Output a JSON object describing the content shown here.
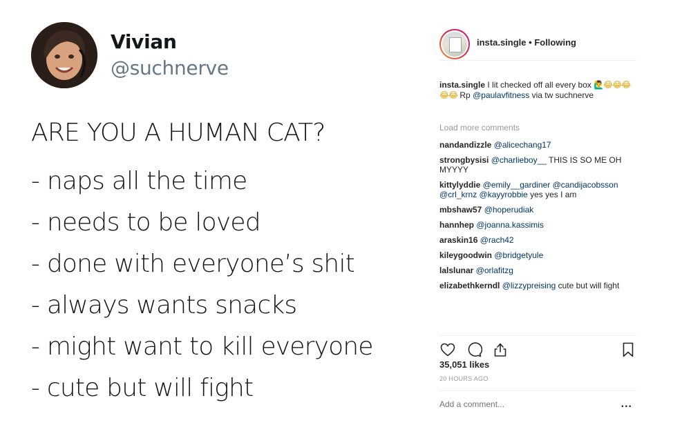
{
  "tweet": {
    "name": "Vivian",
    "handle": "@suchnerve",
    "heading": "ARE YOU A HUMAN CAT?",
    "items": [
      "- naps all the time",
      "- needs to be loved",
      "- done with everyone’s shit",
      "- always wants snacks",
      "- might want to kill everyone",
      "- cute but will fight"
    ]
  },
  "instagram": {
    "header": {
      "username": "insta.single",
      "separator": " • ",
      "follow_status": "Following"
    },
    "caption": {
      "username": "insta.single",
      "text_before": " I lit checked off all every box ",
      "emoji": "🙋‍♂️😂😂😂😂😂",
      "text_rp": " Rp ",
      "mention": "@paulavfitness",
      "text_after": " via tw suchnerve"
    },
    "load_more": "Load more comments",
    "comments": [
      {
        "username": "nandandizzle",
        "mentions": "@alicechang17",
        "text": ""
      },
      {
        "username": "strongbysisi",
        "mentions": "@charlieboy__",
        "text": " THIS IS SO ME OH MYYYY"
      },
      {
        "username": "kittylyddie",
        "mentions": "@emily__gardiner @candijacobsson @crl_krnz @kayyrobbie",
        "text": " yes yes I am"
      },
      {
        "username": "mbshaw57",
        "mentions": "@hoperudiak",
        "text": ""
      },
      {
        "username": "hannhep",
        "mentions": "@joanna.kassimis",
        "text": ""
      },
      {
        "username": "araskin16",
        "mentions": "@rach42",
        "text": ""
      },
      {
        "username": "kileygoodwin",
        "mentions": "@bridgetyule",
        "text": ""
      },
      {
        "username": "lalslunar",
        "mentions": "@orlafitzg",
        "text": ""
      },
      {
        "username": "elizabethkerndl",
        "mentions": "@lizzypreising",
        "text": " cute but will fight"
      }
    ],
    "icons": {
      "like": "heart-icon",
      "comment": "comment-icon",
      "share": "share-icon",
      "save": "bookmark-icon"
    },
    "likes": "35,051 likes",
    "time": "20 HOURS AGO",
    "add_comment_placeholder": "Add a comment...",
    "more": "..."
  },
  "colors": {
    "tweet_name": "#14171a",
    "tweet_handle": "#657786",
    "ig_link": "#003569",
    "ig_muted": "#999999",
    "ig_text": "#262626"
  }
}
